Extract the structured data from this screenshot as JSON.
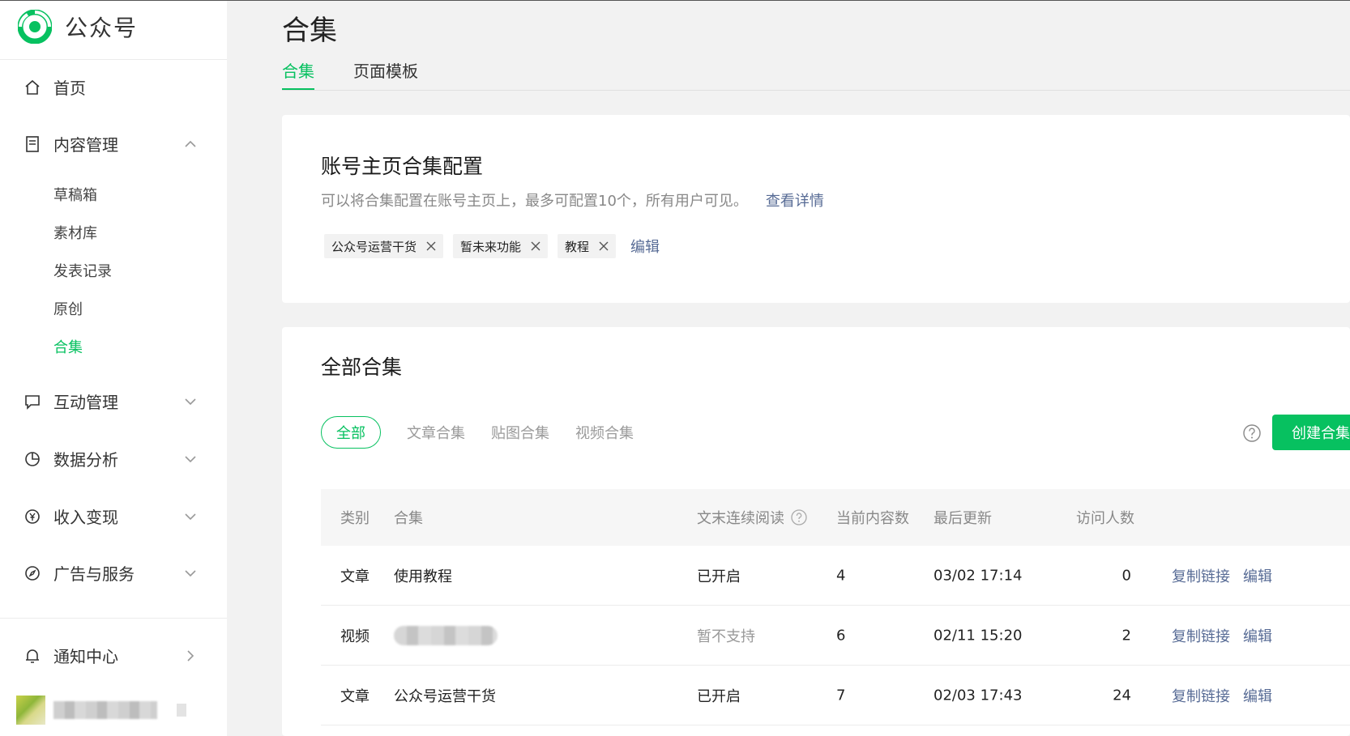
{
  "app": {
    "name": "公众号"
  },
  "sidebar": {
    "home": "首页",
    "content_mgmt": "内容管理",
    "sub_items": [
      "草稿箱",
      "素材库",
      "发表记录",
      "原创",
      "合集"
    ],
    "interaction": "互动管理",
    "analytics": "数据分析",
    "income": "收入变现",
    "ads": "广告与服务",
    "notify": "通知中心"
  },
  "page": {
    "title": "合集",
    "tabs": [
      "合集",
      "页面模板"
    ]
  },
  "homepage_config": {
    "title": "账号主页合集配置",
    "desc": "可以将合集配置在账号主页上，最多可配置10个，所有用户可见。",
    "detail_link": "查看详情",
    "chips": [
      "公众号运营干货",
      "暂未来功能",
      "教程"
    ],
    "edit_label": "编辑"
  },
  "all_collections": {
    "title": "全部合集",
    "filters": [
      "全部",
      "文章合集",
      "贴图合集",
      "视频合集"
    ],
    "create_button": "创建合集",
    "columns": {
      "type": "类别",
      "name": "合集",
      "continuous": "文末连续阅读",
      "count": "当前内容数",
      "updated": "最后更新",
      "visitors": "访问人数"
    },
    "rows": [
      {
        "type": "文章",
        "name": "使用教程",
        "continuous": "已开启",
        "count": "4",
        "updated": "03/02 17:14",
        "visitors": "0",
        "copy": "复制链接",
        "edit": "编辑"
      },
      {
        "type": "视频",
        "name": "",
        "continuous": "暂不支持",
        "count": "6",
        "updated": "02/11 15:20",
        "visitors": "2",
        "copy": "复制链接",
        "edit": "编辑"
      },
      {
        "type": "文章",
        "name": "公众号运营干货",
        "continuous": "已开启",
        "count": "7",
        "updated": "02/03 17:43",
        "visitors": "24",
        "copy": "复制链接",
        "edit": "编辑"
      }
    ]
  },
  "colors": {
    "accent": "#07c160",
    "link": "#576b95"
  }
}
